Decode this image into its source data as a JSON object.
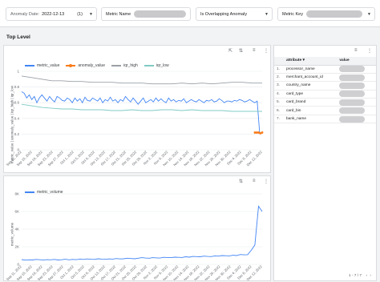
{
  "filters": {
    "anomaly_date_label": "Anomaly Date:",
    "anomaly_date_value": "2022-12-13",
    "anomaly_date_count": "(1)",
    "metric_name_label": "Metric Name",
    "overlapping_label": "Is Overlapping Anomaly",
    "metric_key_label": "Metric Key"
  },
  "section_title": "Top Level",
  "colors": {
    "metric_value": "#4285f4",
    "anomaly_value": "#fa7b17",
    "iqr_high": "#9aa0a6",
    "iqr_low": "#80cbc4",
    "metric_volume": "#4285f4"
  },
  "top_chart": {
    "ylabel": "metric_value | anomaly_value | iqr_high | iqr_low",
    "legend": [
      "metric_value",
      "anomaly_value",
      "iqr_high",
      "iqr_low"
    ]
  },
  "bottom_chart": {
    "ylabel": "metric_volume",
    "legend": [
      "metric_volume"
    ]
  },
  "chart_data": [
    {
      "type": "line",
      "ylim": [
        0,
        1
      ],
      "yticks": [
        "0",
        "0.2",
        "0.4",
        "0.6",
        "0.8",
        "1"
      ],
      "xticks": [
        "Sep 11, 2022",
        "Sep 15, 2022",
        "Sep 19, 2022",
        "Sep 23, 2022",
        "Sep 27, 2022",
        "Oct 1, 2022",
        "Oct 5, 2022",
        "Oct 9, 2022",
        "Oct 13, 2022",
        "Oct 17, 2022",
        "Oct 21, 2022",
        "Oct 25, 2022",
        "Oct 29, 2022",
        "Nov 2, 2022",
        "Nov 6, 2022",
        "Nov 10, 2022",
        "Nov 14, 2022",
        "Nov 18, 2022",
        "Nov 22, 2022",
        "Nov 26, 2022",
        "Nov 30, 2022",
        "Dec 4, 2022",
        "Dec 8, 2022",
        "Dec 12, 2022"
      ],
      "series": [
        {
          "name": "metric_value",
          "values": [
            0.74,
            0.72,
            0.66,
            0.7,
            0.64,
            0.68,
            0.6,
            0.66,
            0.7,
            0.66,
            0.62,
            0.68,
            0.64,
            0.61,
            0.68,
            0.66,
            0.63,
            0.62,
            0.66,
            0.64,
            0.6,
            0.66,
            0.62,
            0.65,
            0.6,
            0.67,
            0.63,
            0.62,
            0.66,
            0.64,
            0.62,
            0.66,
            0.6,
            0.64,
            0.62,
            0.67,
            0.62,
            0.64,
            0.6,
            0.64,
            0.62,
            0.68,
            0.64,
            0.61,
            0.66,
            0.62,
            0.58,
            0.62,
            0.66,
            0.6,
            0.62,
            0.64,
            0.61,
            0.66,
            0.62,
            0.65,
            0.62,
            0.6,
            0.66,
            0.62,
            0.64,
            0.61,
            0.63,
            0.62,
            0.65,
            0.6,
            0.62,
            0.64,
            0.62,
            0.61,
            0.64,
            0.62,
            0.6,
            0.63,
            0.62,
            0.64,
            0.61,
            0.62,
            0.65,
            0.63,
            0.6,
            0.62,
            0.62,
            0.61,
            0.63,
            0.62,
            0.64,
            0.63,
            0.61,
            0.62,
            0.64,
            0.62,
            0.6,
            0.62,
            0.2
          ]
        },
        {
          "name": "anomaly_value",
          "values": [
            0.22,
            0.22,
            0.22,
            0.21,
            0.22
          ]
        },
        {
          "name": "iqr_high",
          "values": [
            0.94,
            0.92,
            0.9,
            0.88,
            0.88,
            0.87,
            0.87,
            0.86,
            0.86,
            0.86,
            0.85,
            0.85,
            0.85,
            0.84,
            0.84,
            0.84,
            0.85,
            0.84,
            0.85,
            0.84,
            0.85,
            0.86,
            0.86,
            0.85,
            0.85
          ]
        },
        {
          "name": "iqr_low",
          "values": [
            0.58,
            0.56,
            0.54,
            0.53,
            0.52,
            0.52,
            0.51,
            0.51,
            0.51,
            0.5,
            0.5,
            0.51,
            0.5,
            0.5,
            0.51,
            0.51,
            0.5,
            0.51,
            0.5,
            0.5,
            0.5,
            0.49,
            0.49,
            0.49,
            0.49
          ]
        }
      ]
    },
    {
      "type": "line",
      "ylim": [
        0,
        8000
      ],
      "yticks": [
        "0",
        "2K",
        "4K",
        "6K",
        "8K"
      ],
      "xticks": [
        "Sep 11, 2022",
        "Sep 15, 2022",
        "Sep 19, 2022",
        "Sep 23, 2022",
        "Sep 27, 2022",
        "Oct 1, 2022",
        "Oct 5, 2022",
        "Oct 9, 2022",
        "Oct 13, 2022",
        "Oct 17, 2022",
        "Oct 21, 2022",
        "Oct 25, 2022",
        "Oct 29, 2022",
        "Nov 2, 2022",
        "Nov 6, 2022",
        "Nov 10, 2022",
        "Nov 14, 2022",
        "Nov 18, 2022",
        "Nov 22, 2022",
        "Nov 26, 2022",
        "Nov 30, 2022",
        "Dec 4, 2022",
        "Dec 8, 2022",
        "Dec 12, 2022"
      ],
      "series": [
        {
          "name": "metric_volume",
          "values": [
            550,
            480,
            520,
            500,
            560,
            530,
            490,
            540,
            520,
            560,
            500,
            530,
            580,
            520,
            560,
            540,
            600,
            560,
            620,
            580,
            560,
            640,
            600,
            580,
            620,
            600,
            660,
            620,
            640,
            700,
            660,
            640,
            700,
            760,
            720,
            700,
            760,
            740,
            720,
            800,
            780,
            760,
            820,
            800,
            780,
            860,
            820,
            900,
            880,
            860,
            940,
            900,
            880,
            960,
            940,
            1000,
            980,
            960,
            1040,
            1000,
            1120,
            1080,
            1100,
            1600,
            2200,
            6600,
            6000
          ]
        }
      ]
    }
  ],
  "table": {
    "headers": [
      "attribute",
      "value"
    ],
    "rows": [
      {
        "num": "1.",
        "attribute": "processor_name"
      },
      {
        "num": "2.",
        "attribute": "merchant_account_id"
      },
      {
        "num": "3.",
        "attribute": "country_name"
      },
      {
        "num": "4.",
        "attribute": "card_type"
      },
      {
        "num": "5.",
        "attribute": "card_brand"
      },
      {
        "num": "6.",
        "attribute": "card_bin"
      },
      {
        "num": "7.",
        "attribute": "bank_name"
      }
    ],
    "pager": "1 - 7 / 7"
  }
}
